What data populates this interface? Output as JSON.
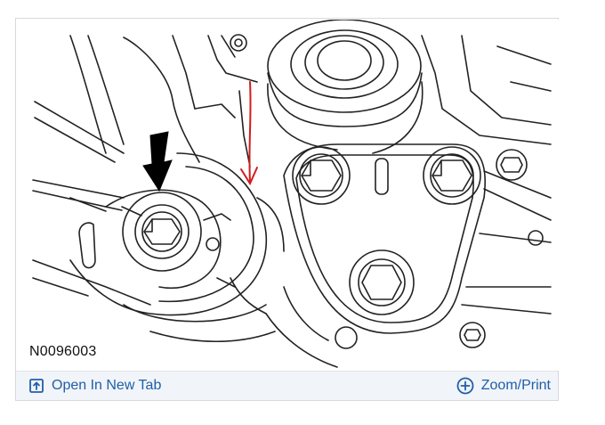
{
  "diagram": {
    "figure_id": "N0096003"
  },
  "toolbar": {
    "open_label": "Open In New Tab",
    "zoom_label": "Zoom/Print",
    "open_icon": "open-in-new-tab-icon",
    "zoom_icon": "plus-circle-icon",
    "link_color": "#1f5fa8"
  },
  "annotation": {
    "arrow_color": "#d21c1c"
  }
}
